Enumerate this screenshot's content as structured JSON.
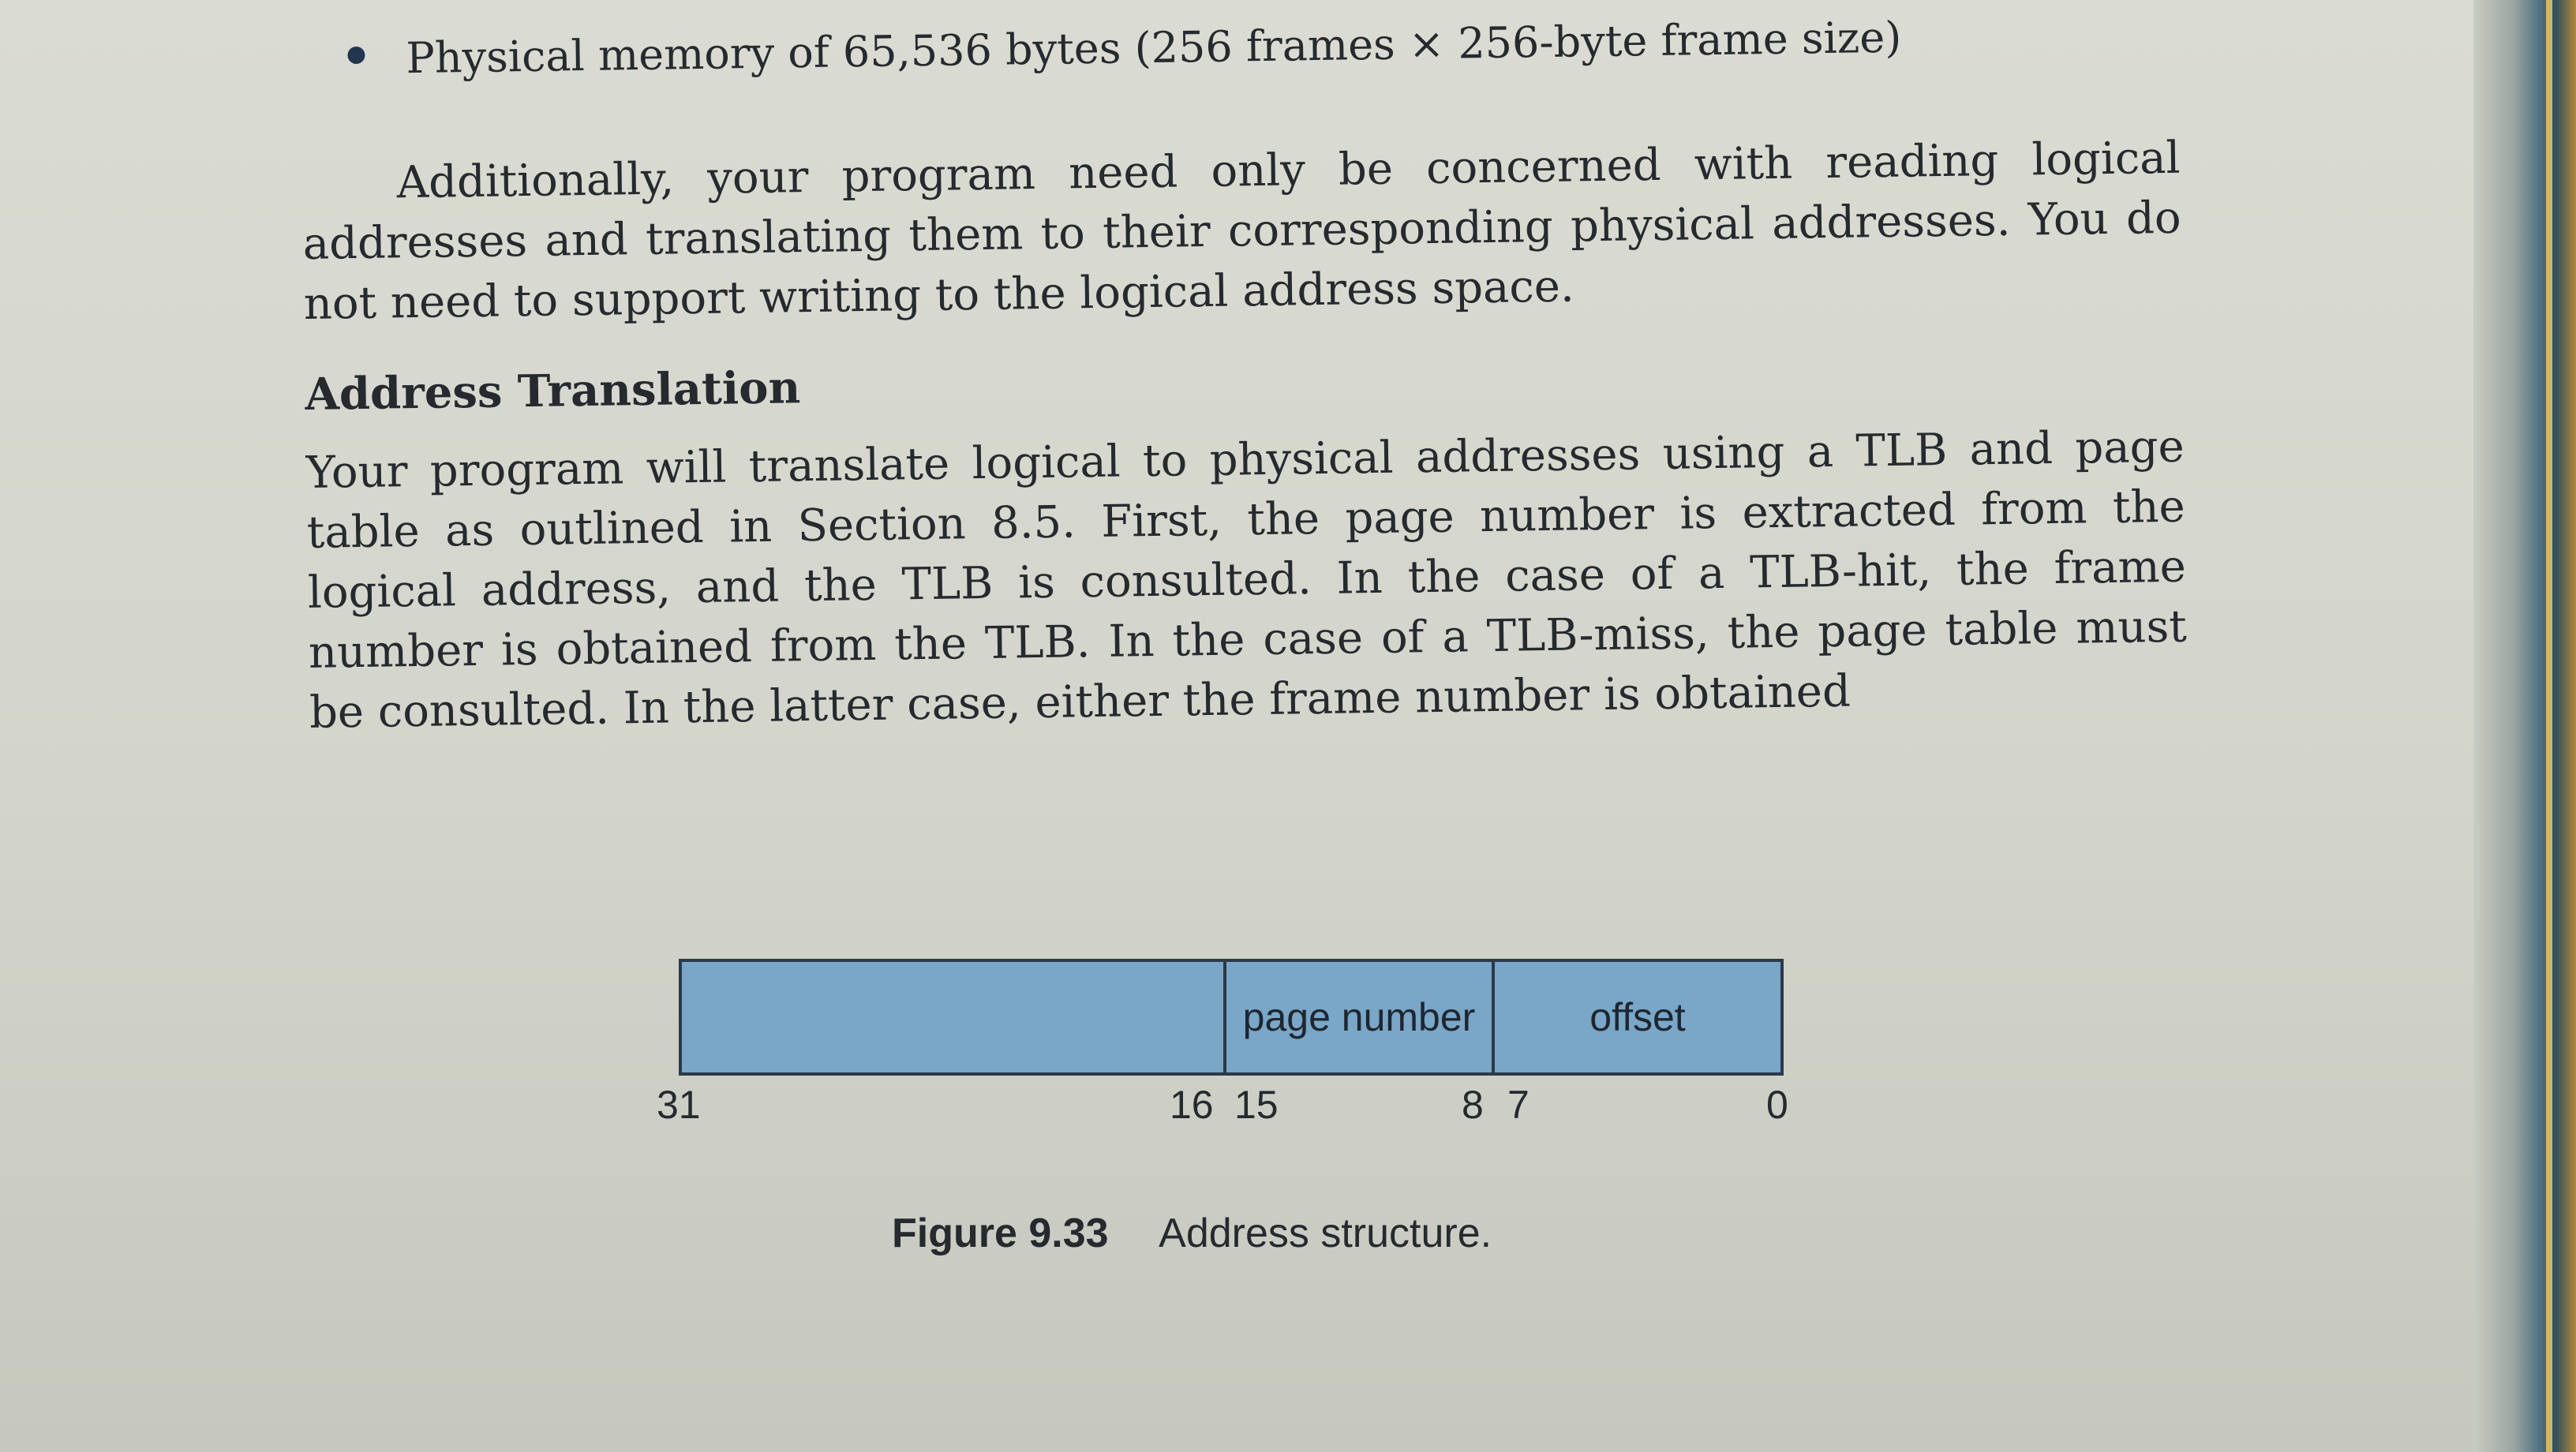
{
  "bullet": {
    "text": "Physical memory of 65,536 bytes (256 frames × 256-byte frame size)"
  },
  "paragraph_1": "Additionally, your program need only be concerned with reading logical addresses and translating them to their corresponding physical addresses. You do not need to support writing to the logical address space.",
  "section": {
    "heading": "Address Translation",
    "paragraph": "Your program will translate logical to physical addresses using a TLB and page table as outlined in Section 8.5. First, the page number is extracted from the logical address, and the TLB is consulted. In the case of a TLB-hit, the frame number is obtained from the TLB. In the case of a TLB-miss, the page table must be consulted. In the latter case, either the frame number is obtained"
  },
  "figure": {
    "segments": {
      "high": "",
      "page_number": "page number",
      "offset": "offset"
    },
    "bit_labels": {
      "b31": "31",
      "b16": "16",
      "b15": "15",
      "b8": "8",
      "b7": "7",
      "b0": "0"
    },
    "caption_label": "Figure 9.33",
    "caption_text": "Address structure."
  },
  "colors": {
    "box_fill": "#7aa6c7",
    "text": "#262a2e"
  }
}
